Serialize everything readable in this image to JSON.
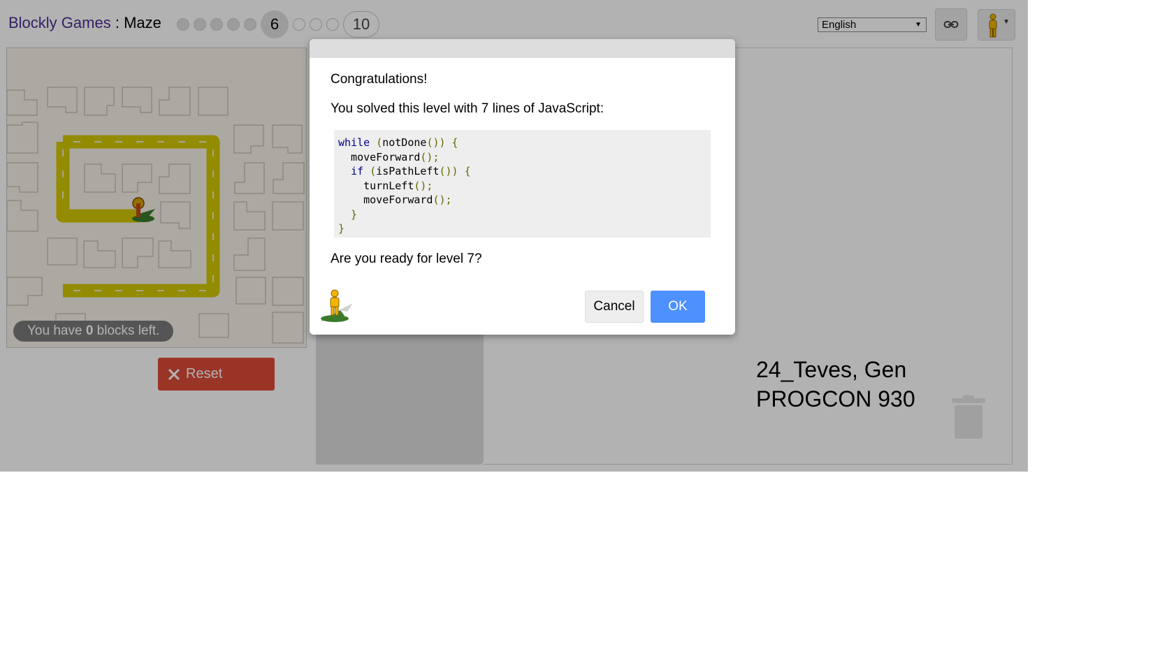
{
  "header": {
    "brand": "Blockly Games",
    "separator": " : ",
    "app": "Maze",
    "current_level": "6",
    "last_level": "10",
    "language": "English"
  },
  "maze": {
    "blocks_left_prefix": "You have ",
    "blocks_left_count": "0",
    "blocks_left_suffix": " blocks left."
  },
  "controls": {
    "reset_label": "Reset"
  },
  "dialog": {
    "congrats": "Congratulations!",
    "solved_text": "You solved this level with 7 lines of JavaScript:",
    "code_lines": [
      "while (notDone()) {",
      "  moveForward();",
      "  if (isPathLeft()) {",
      "    turnLeft();",
      "    moveForward();",
      "  }",
      "}"
    ],
    "ready_text": "Are you ready for level 7?",
    "cancel_label": "Cancel",
    "ok_label": "OK"
  },
  "overlay_text": {
    "line1": "24_Teves, Gen",
    "line2": "PROGCON 930"
  },
  "colors": {
    "brand": "#4b2e91",
    "path": "#d3c900",
    "reset": "#dd4b39",
    "ok": "#4d90fe"
  },
  "icons": [
    "link-icon",
    "pegman-icon",
    "trash-icon",
    "close-x-icon",
    "pegman-marker-icon"
  ]
}
